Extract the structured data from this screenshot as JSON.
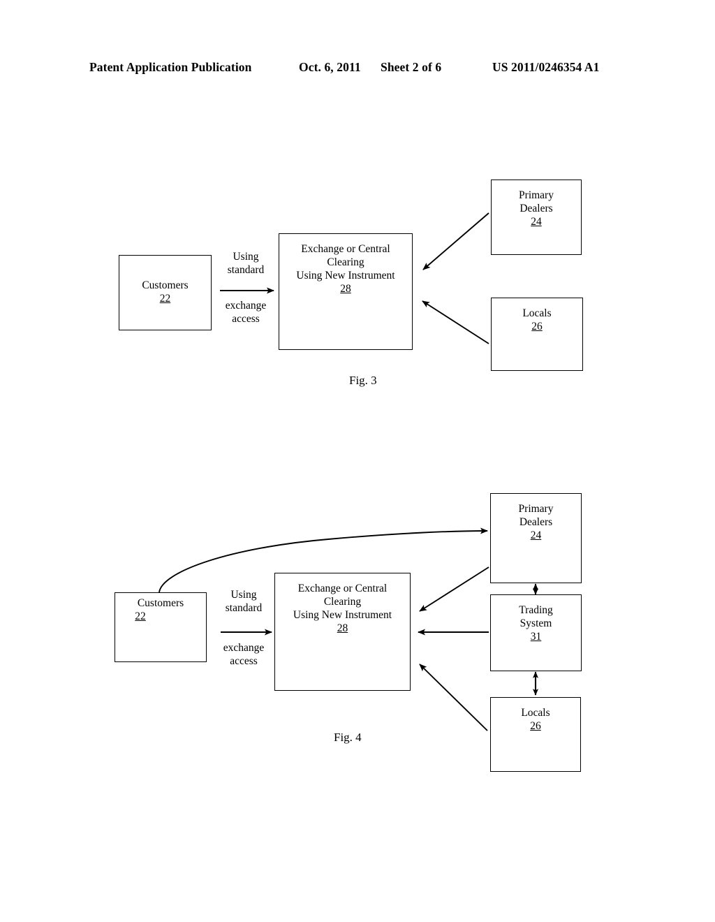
{
  "header": {
    "publication": "Patent Application Publication",
    "date": "Oct. 6, 2011",
    "sheet": "Sheet 2 of 6",
    "patent_number": "US 2011/0246354 A1"
  },
  "figures": [
    {
      "id": "fig3",
      "caption": "Fig. 3",
      "nodes": {
        "customers": {
          "label": "Customers",
          "ref": "22"
        },
        "exchange": {
          "line1": "Exchange or Central",
          "line2": "Clearing",
          "line3": "Using  New Instrument",
          "ref": "28"
        },
        "primary_dealers": {
          "line1": "Primary",
          "line2": "Dealers",
          "ref": "24"
        },
        "locals": {
          "label": "Locals",
          "ref": "26"
        }
      },
      "edges": {
        "customers_to_exchange": {
          "label_top_line1": "Using",
          "label_top_line2": "standard",
          "label_bottom_line1": "exchange",
          "label_bottom_line2": "access"
        }
      }
    },
    {
      "id": "fig4",
      "caption": "Fig. 4",
      "nodes": {
        "customers": {
          "label": "Customers",
          "ref": "22"
        },
        "exchange": {
          "line1": "Exchange or Central",
          "line2": "Clearing",
          "line3": "Using  New Instrument",
          "ref": "28"
        },
        "primary_dealers": {
          "line1": "Primary",
          "line2": "Dealers",
          "ref": "24"
        },
        "trading_system": {
          "line1": "Trading",
          "line2": "System",
          "ref": "31"
        },
        "locals": {
          "label": "Locals",
          "ref": "26"
        }
      },
      "edges": {
        "customers_to_exchange": {
          "label_top_line1": "Using",
          "label_top_line2": "standard",
          "label_bottom_line1": "exchange",
          "label_bottom_line2": "access"
        }
      }
    }
  ],
  "colors": {
    "ink": "#000000",
    "paper": "#ffffff"
  }
}
